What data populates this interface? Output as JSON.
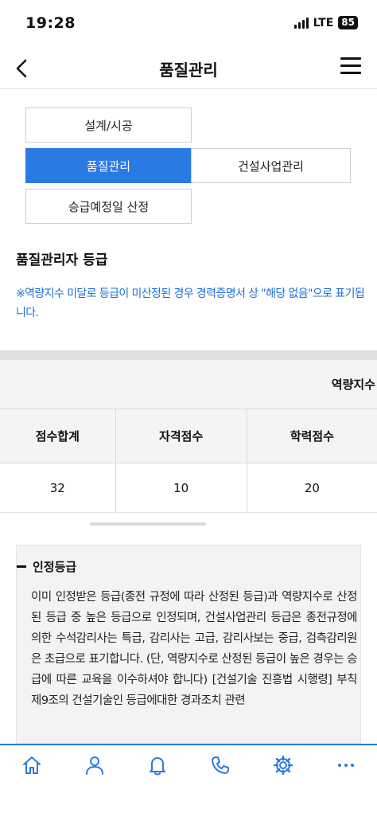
{
  "status_bar": {
    "time": "19:28",
    "network": "LTE",
    "battery": "85"
  },
  "header": {
    "title": "품질관리",
    "back_icon": "back-arrow-icon",
    "menu_icon": "hamburger-menu-icon"
  },
  "segments": [
    {
      "label": "설계/시공",
      "active": false
    },
    {
      "label": "품질관리",
      "active": true
    },
    {
      "label": "건설사업관리",
      "active": false
    },
    {
      "label": "승급예정일 산정",
      "active": false
    }
  ],
  "section": {
    "title": "품질관리자 등급",
    "notice": "※역량지수 미달로 등급이 미산정된 경우 경력증명서 상 \"해당 없음\"으로 표기됩니다."
  },
  "table": {
    "group_header": "역량지수",
    "columns": [
      "점수합계",
      "자격점수",
      "학력점수"
    ],
    "values": [
      "32",
      "10",
      "20"
    ]
  },
  "info": {
    "title": "인정등급",
    "body": "이미 인정받은 등급(종전 규정에 따라 산정된 등급)과 역량지수로 산정된 등급 중 높은 등급으로 인정되며, 건설사업관리 등급은 종전규정에 의한 수석감리사는 특급, 감리사는 고급, 감리사보는 중급, 검측감리원은 초급으로 표기합니다. (단, 역량지수로 산정된 등급이 높은 경우는 승급에 따른 교육을 이수하셔야 합니다) [건설기술 진흥법 시행령] 부칙 제9조의 건설기술인 등급에대한 경과조치 관련"
  },
  "bottom_nav": {
    "items": [
      "home-icon",
      "user-icon",
      "bell-icon",
      "phone-icon",
      "gear-icon",
      "more-icon"
    ],
    "accent_color": "#2b7ae4"
  },
  "colors": {
    "accent": "#2b7ae4",
    "notice_text": "#1f6fd6"
  }
}
